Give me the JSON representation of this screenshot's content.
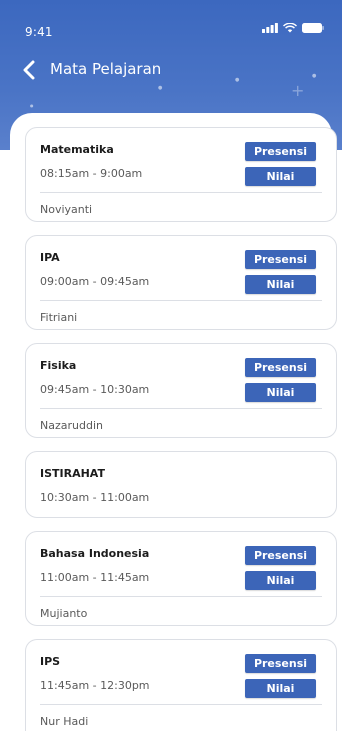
{
  "status_bar": {
    "time": "9:41"
  },
  "header": {
    "title": "Mata Pelajaran"
  },
  "colors": {
    "header": "#3c68bf",
    "button": "#3c65b8"
  },
  "icons": {
    "back": "chevron-left-icon",
    "signal": "signal-icon",
    "wifi": "wifi-icon",
    "battery": "battery-icon"
  },
  "schedule": [
    {
      "subject": "Matematika",
      "time": "08:15am - 9:00am",
      "teacher": "Noviyanti",
      "presensi_label": "Presensi",
      "nilai_label": "Nilai"
    },
    {
      "subject": "IPA",
      "time": "09:00am - 09:45am",
      "teacher": "Fitriani",
      "presensi_label": "Presensi",
      "nilai_label": "Nilai"
    },
    {
      "subject": "Fisika",
      "time": "09:45am - 10:30am",
      "teacher": "Nazaruddin",
      "presensi_label": "Presensi",
      "nilai_label": "Nilai"
    },
    {
      "subject": "ISTIRAHAT",
      "time": "10:30am - 11:00am"
    },
    {
      "subject": "Bahasa Indonesia",
      "time": "11:00am - 11:45am",
      "teacher": "Mujianto",
      "presensi_label": "Presensi",
      "nilai_label": "Nilai"
    },
    {
      "subject": "IPS",
      "time": "11:45am - 12:30pm",
      "teacher": "Nur Hadi",
      "presensi_label": "Presensi",
      "nilai_label": "Nilai"
    }
  ]
}
